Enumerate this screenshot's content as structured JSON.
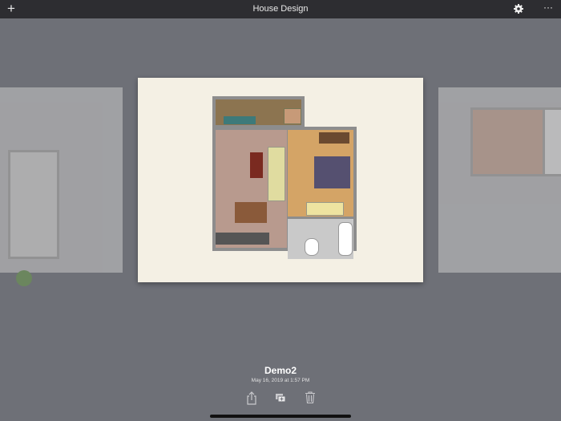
{
  "header": {
    "title": "House Design",
    "add_icon": "plus-icon",
    "settings_icon": "gear-icon",
    "more_icon": "ellipsis-icon"
  },
  "project": {
    "name": "Demo2",
    "date": "May 16, 2019 at 1:57 PM"
  },
  "actions": {
    "share_icon": "share-icon",
    "duplicate_icon": "duplicate-icon",
    "delete_icon": "trash-icon"
  }
}
